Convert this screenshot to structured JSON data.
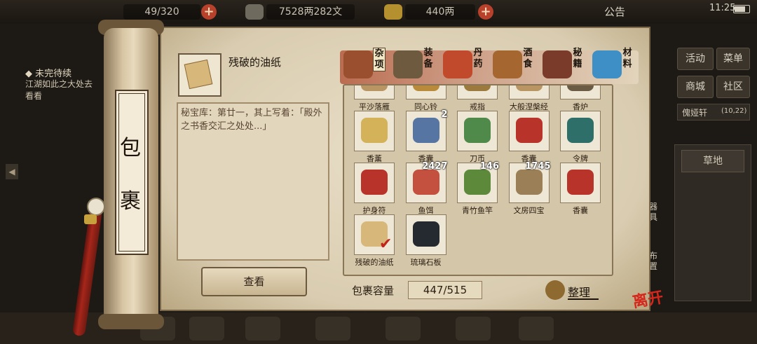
{
  "topbar": {
    "resource1": "49/320",
    "resource2": "7528两282文",
    "resource3": "440两",
    "notice": "公告",
    "time": "11:25"
  },
  "quest": {
    "title": "◆ 未完待续",
    "desc": "江湖如此之大处去看看"
  },
  "right_menu": {
    "activity": "活动",
    "menu": "菜单",
    "shop": "商城",
    "community": "社区",
    "character": "傀娅轩",
    "coords": "(10,22)",
    "location": "草地",
    "tools": "器具",
    "layout": "布置",
    "leave": "离开"
  },
  "bag": {
    "title_line1": "包",
    "title_line2": "裹",
    "selected_item": {
      "name": "残破的油纸",
      "desc": "秘宝库：第廿一，其上写着：「殿外之书香交汇之处处...」"
    },
    "view_button": "查看",
    "capacity_label": "包裹容量",
    "capacity": "447/515",
    "sort_label": "整理",
    "categories": [
      {
        "label": "杂项",
        "icon": "jar-icon",
        "color": "#9a4f2e"
      },
      {
        "label": "装备",
        "icon": "scroll-case-icon",
        "color": "#6d5a3f"
      },
      {
        "label": "丹药",
        "icon": "pills-icon",
        "color": "#c14a2c"
      },
      {
        "label": "酒食",
        "icon": "food-icon",
        "color": "#a5672f"
      },
      {
        "label": "秘籍",
        "icon": "books-icon",
        "color": "#7a3b2a"
      },
      {
        "label": "材料",
        "icon": "crystal-icon",
        "color": "#3f8fc7"
      }
    ],
    "items": [
      {
        "label": "平沙落雁",
        "icon": "book-icon",
        "color": "#b99563",
        "count": ""
      },
      {
        "label": "同心铃",
        "icon": "bell-icon",
        "color": "#b88a3a",
        "count": ""
      },
      {
        "label": "戒指",
        "icon": "ring-icon",
        "color": "#9c7a3e",
        "count": ""
      },
      {
        "label": "大般涅槃经",
        "icon": "sutra-icon",
        "color": "#b99563",
        "count": ""
      },
      {
        "label": "香炉",
        "icon": "censer-icon",
        "color": "#6b5a44",
        "count": ""
      },
      {
        "label": "香薰",
        "icon": "candle-icon",
        "color": "#d3b25a",
        "count": ""
      },
      {
        "label": "香囊",
        "icon": "sachet-blue-icon",
        "color": "#5675a3",
        "count": "2"
      },
      {
        "label": "刀币",
        "icon": "knife-coin-icon",
        "color": "#4f8a4a",
        "count": ""
      },
      {
        "label": "香囊",
        "icon": "sachet-red-icon",
        "color": "#b8332a",
        "count": ""
      },
      {
        "label": "令牌",
        "icon": "token-icon",
        "color": "#2f6f6a",
        "count": ""
      },
      {
        "label": "护身符",
        "icon": "amulet-icon",
        "color": "#b8332a",
        "count": ""
      },
      {
        "label": "鱼饵",
        "icon": "worm-icon",
        "color": "#c45040",
        "count": "2427"
      },
      {
        "label": "青竹鱼竿",
        "icon": "fishing-rod-icon",
        "color": "#5d8a3a",
        "count": "146"
      },
      {
        "label": "文房四宝",
        "icon": "stationery-icon",
        "color": "#9b7f56",
        "count": "1745"
      },
      {
        "label": "香囊",
        "icon": "sachet-red-icon",
        "color": "#b8332a",
        "count": ""
      },
      {
        "label": "残破的油纸",
        "icon": "oil-paper-icon",
        "color": "#d8b77a",
        "count": ""
      },
      {
        "label": "琉璃石板",
        "icon": "stone-tablet-icon",
        "color": "#252a30",
        "count": ""
      }
    ]
  }
}
